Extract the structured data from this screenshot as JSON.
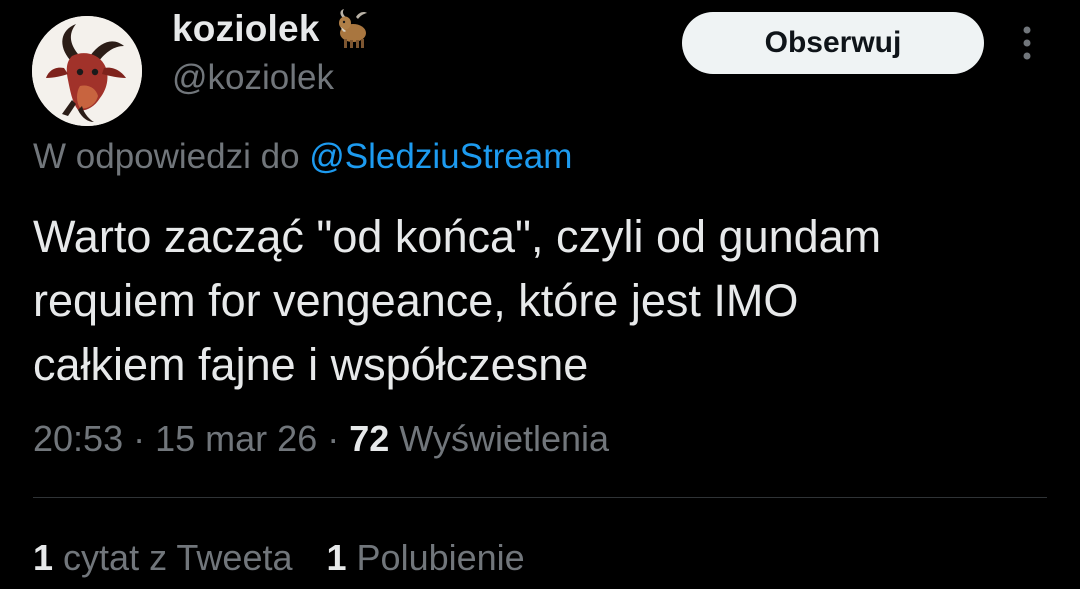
{
  "author": {
    "display_name": "koziolek",
    "name_emoji": "goat-icon",
    "handle": "@koziolek",
    "avatar_icon": "goat-head-icon"
  },
  "follow_button": {
    "label": "Obserwuj"
  },
  "more_menu_icon": "vertical-ellipsis-icon",
  "reply_context": {
    "prefix": "W odpowiedzi do",
    "mention": "@SledziuStream"
  },
  "tweet": {
    "text_lines": [
      "Warto zacząć \"od końca\", czyli od gundam",
      "requiem for vengeance, które jest IMO",
      "całkiem fajne i współczesne"
    ]
  },
  "meta": {
    "time": "20:53",
    "separator": "·",
    "date": "15 mar 26",
    "views_count": "72",
    "views_label": "Wyświetlenia"
  },
  "stats": {
    "quotes_count": "1",
    "quotes_label": "cytat z Tweeta",
    "likes_count": "1",
    "likes_label": "Polubienie"
  },
  "colors": {
    "background": "#000000",
    "primary_text": "#e7e9ea",
    "secondary_text": "#71767b",
    "link": "#1d9bf0",
    "button_bg": "#eff3f4",
    "button_text": "#0f1419",
    "divider": "#2f3336"
  }
}
